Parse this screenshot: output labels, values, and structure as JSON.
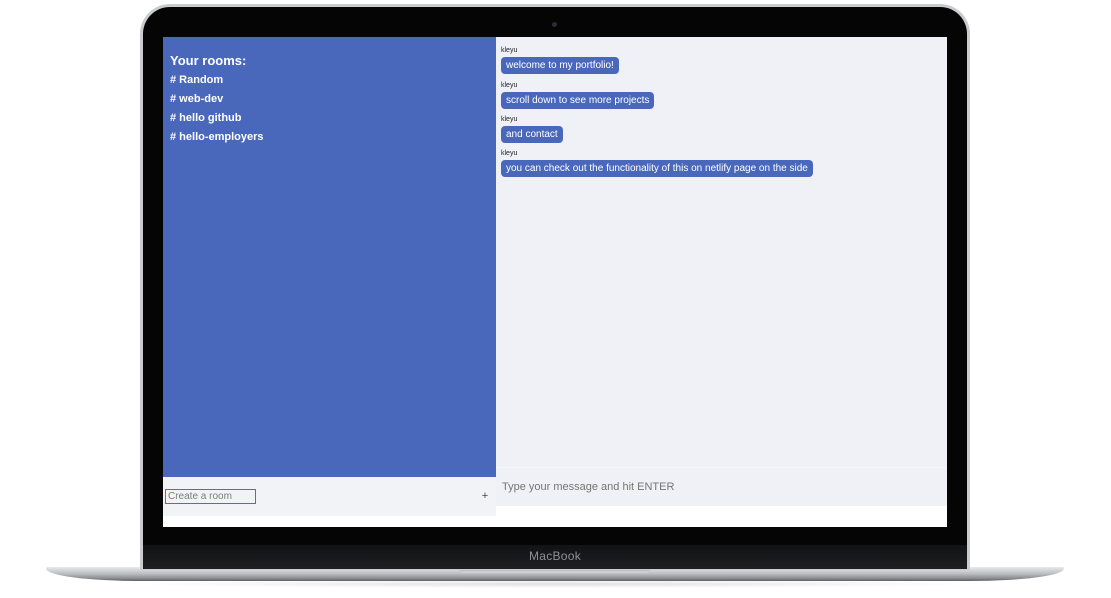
{
  "device": {
    "brand_label": "MacBook"
  },
  "sidebar": {
    "title": "Your rooms:",
    "rooms": [
      {
        "label": "# Random"
      },
      {
        "label": "# web-dev"
      },
      {
        "label": "# hello github"
      },
      {
        "label": "# hello-employers"
      }
    ],
    "create_room": {
      "placeholder": "Create a room",
      "value": "",
      "add_button_label": "+"
    }
  },
  "chat": {
    "messages": [
      {
        "author": "kleyu",
        "text": "welcome to my portfolio!"
      },
      {
        "author": "kleyu",
        "text": "scroll down to see more projects"
      },
      {
        "author": "kleyu",
        "text": "and contact"
      },
      {
        "author": "kleyu",
        "text": "you can check out the functionality of this on netlify page on the side"
      }
    ],
    "scroll_arrow": "‹",
    "compose": {
      "placeholder": "Type your message and hit ENTER",
      "value": ""
    }
  },
  "colors": {
    "accent": "#4a68bb",
    "chat_background": "#f0f1f6",
    "input_highlight": "#e23c3c"
  },
  "icons": {
    "camera": "camera-icon",
    "add_room": "plus-icon"
  }
}
